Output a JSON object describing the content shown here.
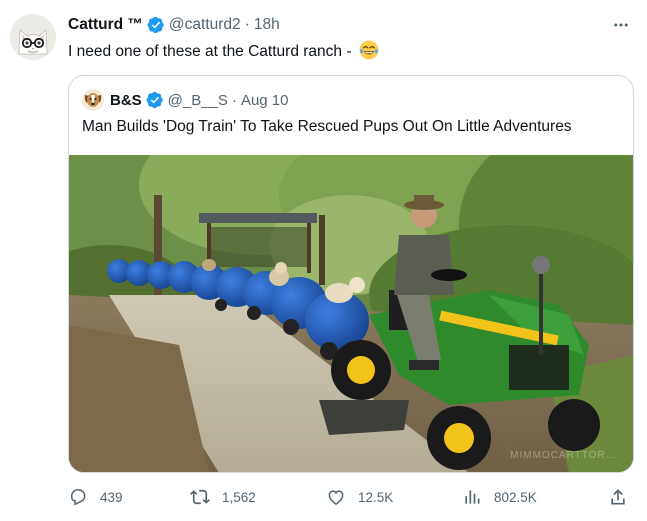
{
  "tweet": {
    "author": {
      "display_name": "Catturd ™",
      "handle": "@catturd2",
      "verified": true,
      "avatar_icon": "cat-with-glasses-avatar"
    },
    "separator": "·",
    "time": "18h",
    "text": "I need one of these at the Catturd ranch - ",
    "emoji": "😂",
    "more_icon": "more-icon"
  },
  "quote": {
    "author": {
      "display_name": "B&S",
      "handle": "@_B__S",
      "verified": true,
      "avatar_icon": "dog-avatar"
    },
    "separator": "·",
    "time": "Aug 10",
    "text": "Man Builds 'Dog Train' To Take Rescued Pups Out On Little Adventures",
    "media": {
      "description_icon": "dog-train-photo",
      "watermark": "MIMMOCARTTOR..."
    }
  },
  "actions": {
    "replies": "439",
    "retweets": "1,562",
    "likes": "12.5K",
    "views": "802.5K"
  },
  "colors": {
    "text_primary": "#0f1419",
    "text_secondary": "#536471",
    "verified_blue": "#1d9bf0",
    "border": "#cfd9de"
  }
}
